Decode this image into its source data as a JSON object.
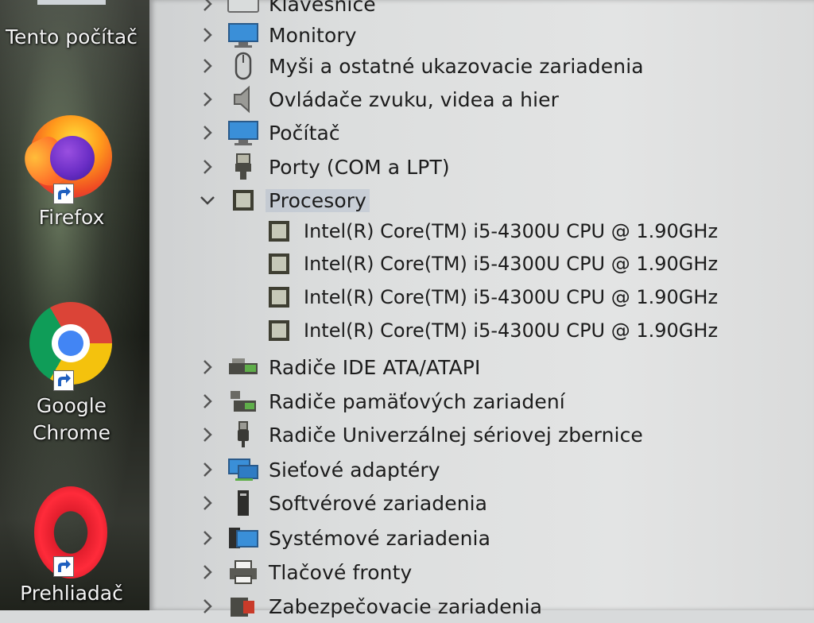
{
  "desktop": {
    "icons": [
      {
        "label": "Tento počítač",
        "icon": "this-pc-icon"
      },
      {
        "label": "Firefox",
        "icon": "firefox-icon"
      },
      {
        "label_line1": "Google",
        "label_line2": "Chrome",
        "icon": "chrome-icon"
      },
      {
        "label": "Prehliadač",
        "icon": "opera-icon"
      }
    ]
  },
  "device_tree": {
    "categories": [
      {
        "label": "Klávesnice",
        "icon": "keyboard-icon",
        "expanded": false
      },
      {
        "label": "Monitory",
        "icon": "monitor-icon",
        "expanded": false
      },
      {
        "label": "Myši a ostatné ukazovacie zariadenia",
        "icon": "mouse-icon",
        "expanded": false
      },
      {
        "label": "Ovládače zvuku, videa a hier",
        "icon": "speaker-icon",
        "expanded": false
      },
      {
        "label": "Počítač",
        "icon": "computer-icon",
        "expanded": false
      },
      {
        "label": "Porty (COM a LPT)",
        "icon": "port-icon",
        "expanded": false
      },
      {
        "label": "Procesory",
        "icon": "processor-icon",
        "expanded": true,
        "children": [
          "Intel(R) Core(TM) i5-4300U CPU @ 1.90GHz",
          "Intel(R) Core(TM) i5-4300U CPU @ 1.90GHz",
          "Intel(R) Core(TM) i5-4300U CPU @ 1.90GHz",
          "Intel(R) Core(TM) i5-4300U CPU @ 1.90GHz"
        ]
      },
      {
        "label": "Radiče IDE ATA/ATAPI",
        "icon": "ide-controller-icon",
        "expanded": false
      },
      {
        "label": "Radiče pamäťových zariadení",
        "icon": "storage-controller-icon",
        "expanded": false
      },
      {
        "label": "Radiče Univerzálnej sériovej zbernice",
        "icon": "usb-icon",
        "expanded": false
      },
      {
        "label": "Sieťové adaptéry",
        "icon": "network-adapter-icon",
        "expanded": false
      },
      {
        "label": "Softvérové zariadenia",
        "icon": "software-device-icon",
        "expanded": false
      },
      {
        "label": "Systémové zariadenia",
        "icon": "system-device-icon",
        "expanded": false
      },
      {
        "label": "Tlačové fronty",
        "icon": "print-queue-icon",
        "expanded": false
      },
      {
        "label": "Zabezpečovacie zariadenia",
        "icon": "security-device-icon",
        "expanded": false
      }
    ]
  }
}
